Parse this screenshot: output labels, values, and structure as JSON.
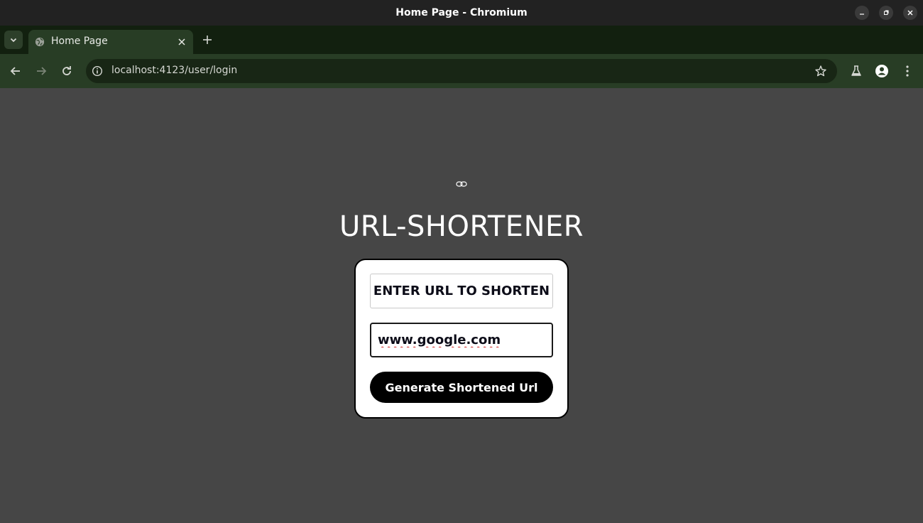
{
  "window": {
    "title": "Home Page - Chromium"
  },
  "tabs": [
    {
      "title": "Home Page",
      "favicon": "globe-icon"
    }
  ],
  "toolbar": {
    "url": "localhost:4123/user/login",
    "icons": [
      "back-icon",
      "forward-icon",
      "reload-icon",
      "site-info-icon",
      "bookmark-star-icon",
      "labs-flask-icon",
      "profile-icon",
      "menu-kebab-icon"
    ]
  },
  "page": {
    "icon": "link-icon",
    "title": "URL-SHORTENER",
    "form": {
      "label": "ENTER URL TO SHORTEN",
      "input_value": "www.google.com",
      "button_label": "Generate Shortened Url"
    }
  },
  "colors": {
    "page_background": "#464646",
    "toolbar": "#283d25",
    "tabstrip": "#12200f",
    "button": "#000000"
  }
}
